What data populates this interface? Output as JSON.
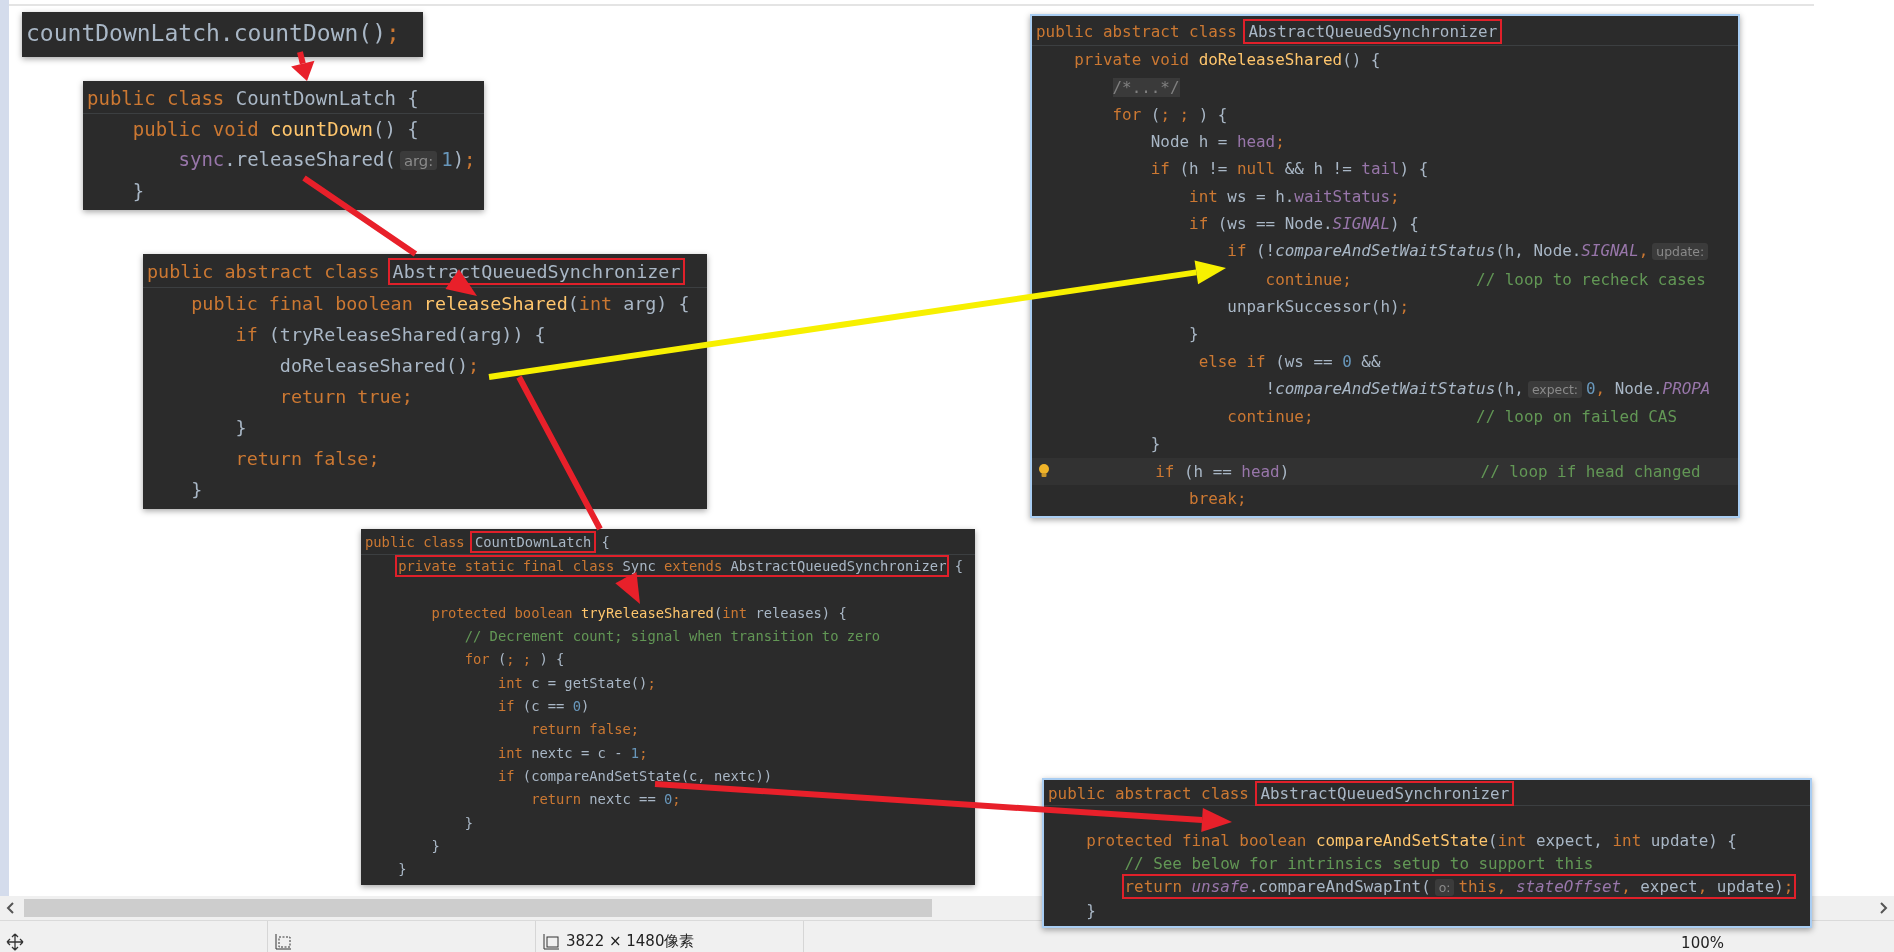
{
  "panels": [
    {
      "lines": [
        {
          "kind": "code",
          "tokens": [
            {
              "kind": "plain",
              "text": "countDownLatch.countDown()"
            },
            {
              "kind": "kw",
              "text": ";"
            }
          ]
        }
      ]
    },
    {
      "header": [
        {
          "kind": "kw",
          "text": "public class "
        },
        {
          "kind": "plain",
          "text": "CountDownLatch {"
        }
      ],
      "lines": [
        {
          "kind": "code",
          "tokens": [
            {
              "kind": "kw",
              "text": "    public void "
            },
            {
              "kind": "fn",
              "text": "countDown"
            },
            {
              "kind": "plain",
              "text": "() {"
            }
          ]
        },
        {
          "kind": "code",
          "tokens": [
            {
              "kind": "field",
              "text": "        sync"
            },
            {
              "kind": "plain",
              "text": ".releaseShared("
            },
            {
              "kind": "hint",
              "text": "arg:"
            },
            {
              "kind": "num",
              "text": "1"
            },
            {
              "kind": "plain",
              "text": ")"
            },
            {
              "kind": "kw",
              "text": ";"
            }
          ]
        },
        {
          "kind": "code",
          "tokens": [
            {
              "kind": "plain",
              "text": "    }"
            }
          ]
        }
      ]
    },
    {
      "header": [
        {
          "kind": "kw",
          "text": "public abstract class "
        },
        {
          "kind": "boxed",
          "text": "AbstractQueuedSynchronizer"
        }
      ],
      "lines": [
        {
          "kind": "code",
          "tokens": [
            {
              "kind": "kw",
              "text": "    public final boolean "
            },
            {
              "kind": "fn",
              "text": "releaseShared"
            },
            {
              "kind": "plain",
              "text": "("
            },
            {
              "kind": "kw",
              "text": "int "
            },
            {
              "kind": "plain",
              "text": "arg) {"
            }
          ]
        },
        {
          "kind": "code",
          "tokens": [
            {
              "kind": "kw",
              "text": "        if "
            },
            {
              "kind": "plain",
              "text": "(tryReleaseShared(arg)) {"
            }
          ]
        },
        {
          "kind": "code",
          "tokens": [
            {
              "kind": "plain",
              "text": "            doReleaseShared()"
            },
            {
              "kind": "kw",
              "text": ";"
            }
          ]
        },
        {
          "kind": "code",
          "tokens": [
            {
              "kind": "kw",
              "text": "            return true;"
            }
          ]
        },
        {
          "kind": "code",
          "tokens": [
            {
              "kind": "plain",
              "text": "        }"
            }
          ]
        },
        {
          "kind": "code",
          "tokens": [
            {
              "kind": "kw",
              "text": "        return false;"
            }
          ]
        },
        {
          "kind": "code",
          "tokens": [
            {
              "kind": "plain",
              "text": "    }"
            }
          ]
        }
      ]
    },
    {
      "header": [
        {
          "kind": "kw",
          "text": "public class "
        },
        {
          "kind": "boxed",
          "text": "CountDownLatch"
        },
        {
          "kind": "plain",
          "text": " {"
        }
      ],
      "lines": [
        {
          "kind": "boxed",
          "tokens": [
            {
              "kind": "kw",
              "text": "private static final class "
            },
            {
              "kind": "plain",
              "text": "Sync "
            },
            {
              "kind": "kw",
              "text": "extends "
            },
            {
              "kind": "plain",
              "text": "AbstractQueuedSynchronizer"
            }
          ],
          "after": " {"
        },
        {
          "kind": "blank"
        },
        {
          "kind": "code",
          "tokens": [
            {
              "kind": "kw",
              "text": "        protected boolean "
            },
            {
              "kind": "fn",
              "text": "tryReleaseShared"
            },
            {
              "kind": "plain",
              "text": "("
            },
            {
              "kind": "kw",
              "text": "int "
            },
            {
              "kind": "plain",
              "text": "releases) {"
            }
          ]
        },
        {
          "kind": "code",
          "tokens": [
            {
              "kind": "comment",
              "text": "            // Decrement count; signal when transition to zero"
            }
          ]
        },
        {
          "kind": "code",
          "tokens": [
            {
              "kind": "kw",
              "text": "            for "
            },
            {
              "kind": "plain",
              "text": "("
            },
            {
              "kind": "kw",
              "text": "; ; "
            },
            {
              "kind": "plain",
              "text": ") {"
            }
          ]
        },
        {
          "kind": "code",
          "tokens": [
            {
              "kind": "kw",
              "text": "                int "
            },
            {
              "kind": "plain",
              "text": "c = getState()"
            },
            {
              "kind": "kw",
              "text": ";"
            }
          ]
        },
        {
          "kind": "code",
          "tokens": [
            {
              "kind": "kw",
              "text": "                if "
            },
            {
              "kind": "plain",
              "text": "(c == "
            },
            {
              "kind": "num",
              "text": "0"
            },
            {
              "kind": "plain",
              "text": ")"
            }
          ]
        },
        {
          "kind": "code",
          "tokens": [
            {
              "kind": "kw",
              "text": "                    return false;"
            }
          ]
        },
        {
          "kind": "code",
          "tokens": [
            {
              "kind": "kw",
              "text": "                int "
            },
            {
              "kind": "plain",
              "text": "nextc = c - "
            },
            {
              "kind": "num",
              "text": "1"
            },
            {
              "kind": "kw",
              "text": ";"
            }
          ]
        },
        {
          "kind": "code",
          "tokens": [
            {
              "kind": "kw",
              "text": "                if "
            },
            {
              "kind": "plain",
              "text": "(compareAndSetState(c, nextc))"
            }
          ]
        },
        {
          "kind": "code",
          "tokens": [
            {
              "kind": "kw",
              "text": "                    return "
            },
            {
              "kind": "plain",
              "text": "nextc == "
            },
            {
              "kind": "num",
              "text": "0"
            },
            {
              "kind": "kw",
              "text": ";"
            }
          ]
        },
        {
          "kind": "code",
          "tokens": [
            {
              "kind": "plain",
              "text": "            }"
            }
          ]
        },
        {
          "kind": "code",
          "tokens": [
            {
              "kind": "plain",
              "text": "        }"
            }
          ]
        },
        {
          "kind": "code",
          "tokens": [
            {
              "kind": "plain",
              "text": "    }"
            }
          ]
        }
      ]
    },
    {
      "header": [
        {
          "kind": "kw",
          "text": "public abstract class "
        },
        {
          "kind": "boxed",
          "text": "AbstractQueuedSynchronizer"
        }
      ],
      "lines": [
        {
          "kind": "code",
          "tokens": [
            {
              "kind": "kw",
              "text": "    private void "
            },
            {
              "kind": "fn",
              "text": "doReleaseShared"
            },
            {
              "kind": "plain",
              "text": "() {"
            }
          ]
        },
        {
          "kind": "code",
          "tokens": [
            {
              "kind": "fold",
              "text": "/*...*/"
            }
          ]
        },
        {
          "kind": "code",
          "tokens": [
            {
              "kind": "kw",
              "text": "        for "
            },
            {
              "kind": "plain",
              "text": "("
            },
            {
              "kind": "kw",
              "text": "; ; "
            },
            {
              "kind": "plain",
              "text": ") {"
            }
          ]
        },
        {
          "kind": "code",
          "tokens": [
            {
              "kind": "plain",
              "text": "            Node h = "
            },
            {
              "kind": "field",
              "text": "head"
            },
            {
              "kind": "kw",
              "text": ";"
            }
          ]
        },
        {
          "kind": "code",
          "tokens": [
            {
              "kind": "kw",
              "text": "            if "
            },
            {
              "kind": "plain",
              "text": "(h != "
            },
            {
              "kind": "kw",
              "text": "null "
            },
            {
              "kind": "plain",
              "text": "&& h != "
            },
            {
              "kind": "field",
              "text": "tail"
            },
            {
              "kind": "plain",
              "text": ") {"
            }
          ]
        },
        {
          "kind": "code",
          "tokens": [
            {
              "kind": "kw",
              "text": "                int "
            },
            {
              "kind": "plain",
              "text": "ws = h."
            },
            {
              "kind": "field",
              "text": "waitStatus"
            },
            {
              "kind": "kw",
              "text": ";"
            }
          ]
        },
        {
          "kind": "code",
          "tokens": [
            {
              "kind": "kw",
              "text": "                if "
            },
            {
              "kind": "plain",
              "text": "(ws == Node."
            },
            {
              "kind": "static",
              "text": "SIGNAL"
            },
            {
              "kind": "plain",
              "text": ") {"
            }
          ]
        },
        {
          "kind": "code",
          "tokens": [
            {
              "kind": "kw",
              "text": "                    if "
            },
            {
              "kind": "plain",
              "text": "(!"
            },
            {
              "kind": "italic",
              "text": "compareAndSetWaitStatus"
            },
            {
              "kind": "plain",
              "text": "(h, Node."
            },
            {
              "kind": "static",
              "text": "SIGNAL"
            },
            {
              "kind": "kw",
              "text": ","
            },
            {
              "kind": "hint",
              "text": "update:"
            }
          ]
        },
        {
          "kind": "code",
          "tokens": [
            {
              "kind": "kw",
              "text": "                        continue;"
            },
            {
              "kind": "comment",
              "text": "             // loop to recheck cases"
            }
          ]
        },
        {
          "kind": "code",
          "tokens": [
            {
              "kind": "plain",
              "text": "                    unparkSuccessor(h)"
            },
            {
              "kind": "kw",
              "text": ";"
            }
          ]
        },
        {
          "kind": "code",
          "tokens": [
            {
              "kind": "plain",
              "text": "                }"
            }
          ]
        },
        {
          "kind": "code",
          "tokens": [
            {
              "kind": "kw",
              "text": "                 else if "
            },
            {
              "kind": "plain",
              "text": "(ws == "
            },
            {
              "kind": "num",
              "text": "0 "
            },
            {
              "kind": "plain",
              "text": "&&"
            }
          ]
        },
        {
          "kind": "code",
          "tokens": [
            {
              "kind": "plain",
              "text": "                        !"
            },
            {
              "kind": "italic",
              "text": "compareAndSetWaitStatus"
            },
            {
              "kind": "plain",
              "text": "(h,"
            },
            {
              "kind": "hint",
              "text": "expect:"
            },
            {
              "kind": "num",
              "text": "0"
            },
            {
              "kind": "kw",
              "text": ", "
            },
            {
              "kind": "plain",
              "text": "Node."
            },
            {
              "kind": "static",
              "text": "PROPA"
            }
          ]
        },
        {
          "kind": "code",
          "tokens": [
            {
              "kind": "kw",
              "text": "                    continue;"
            },
            {
              "kind": "comment",
              "text": "                 // loop on failed CAS"
            }
          ]
        },
        {
          "kind": "code",
          "tokens": [
            {
              "kind": "plain",
              "text": "            }"
            }
          ]
        },
        {
          "kind": "current",
          "tokens": [
            {
              "kind": "kw",
              "text": "           if "
            },
            {
              "kind": "plain",
              "text": "(h == "
            },
            {
              "kind": "field",
              "text": "head"
            },
            {
              "kind": "plain",
              "text": ")"
            },
            {
              "kind": "comment",
              "text": "                    // loop if head changed"
            }
          ]
        },
        {
          "kind": "code",
          "tokens": [
            {
              "kind": "kw",
              "text": "                break;"
            }
          ]
        }
      ]
    },
    {
      "header": [
        {
          "kind": "kw",
          "text": "public abstract class "
        },
        {
          "kind": "boxed",
          "text": "AbstractQueuedSynchronizer"
        }
      ],
      "lines": [
        {
          "kind": "blank"
        },
        {
          "kind": "code",
          "tokens": [
            {
              "kind": "kw",
              "text": "    protected final boolean "
            },
            {
              "kind": "fn",
              "text": "compareAndSetState"
            },
            {
              "kind": "plain",
              "text": "("
            },
            {
              "kind": "kw",
              "text": "int "
            },
            {
              "kind": "plain",
              "text": "expect, "
            },
            {
              "kind": "kw",
              "text": "int "
            },
            {
              "kind": "plain",
              "text": "update) {"
            }
          ]
        },
        {
          "kind": "code",
          "tokens": [
            {
              "kind": "comment",
              "text": "        // See below for intrinsics setup to support this"
            }
          ]
        },
        {
          "kind": "boxed",
          "tokens": [
            {
              "kind": "kw",
              "text": "return "
            },
            {
              "kind": "static",
              "text": "unsafe"
            },
            {
              "kind": "plain",
              "text": ".compareAndSwapInt("
            },
            {
              "kind": "hint",
              "text": "o:"
            },
            {
              "kind": "kw",
              "text": "this, "
            },
            {
              "kind": "static",
              "text": "stateOffset"
            },
            {
              "kind": "kw",
              "text": ", "
            },
            {
              "kind": "plain",
              "text": "expect"
            },
            {
              "kind": "kw",
              "text": ", "
            },
            {
              "kind": "plain",
              "text": "update)"
            },
            {
              "kind": "kw",
              "text": ";"
            }
          ]
        },
        {
          "kind": "code",
          "tokens": [
            {
              "kind": "plain",
              "text": "    }"
            }
          ]
        }
      ]
    }
  ],
  "status_bar": {
    "image_size": "3822 × 1480像素",
    "zoom": "100%"
  }
}
